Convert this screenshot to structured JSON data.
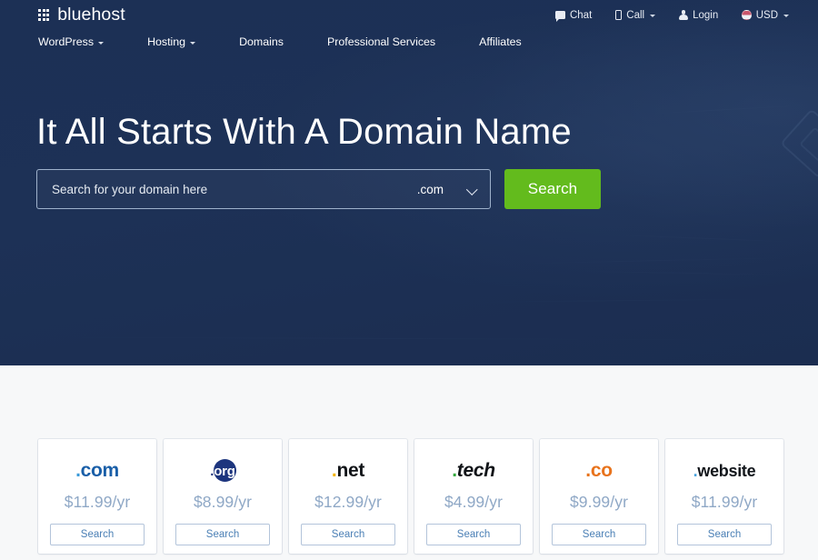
{
  "brand": {
    "name": "bluehost",
    "logo_icon": "grid-dots-icon"
  },
  "topbar": {
    "items": [
      {
        "label": "Chat",
        "icon": "chat-icon",
        "caret": false
      },
      {
        "label": "Call",
        "icon": "phone-icon",
        "caret": true
      },
      {
        "label": "Login",
        "icon": "user-icon",
        "caret": false
      },
      {
        "label": "USD",
        "icon": "currency-flag-icon",
        "caret": true
      }
    ]
  },
  "mainnav": {
    "items": [
      {
        "label": "WordPress",
        "caret": true
      },
      {
        "label": "Hosting",
        "caret": true
      },
      {
        "label": "Domains",
        "caret": false
      },
      {
        "label": "Professional Services",
        "caret": false
      },
      {
        "label": "Affiliates",
        "caret": false
      }
    ]
  },
  "hero": {
    "title": "It All Starts With A Domain Name",
    "background_color": "#1c3055"
  },
  "search": {
    "placeholder": "Search for your domain here",
    "value": "",
    "tld_selected": ".com",
    "dropdown_icon": "chevron-down-icon",
    "button_label": "Search",
    "button_color": "#63bb1d"
  },
  "tld_cards": {
    "button_label": "Search",
    "items": [
      {
        "tld": ".com",
        "name": "com",
        "price": "$11.99/yr",
        "dot_color": "#3a9ad9",
        "text_color": "#1a5fa8"
      },
      {
        "tld": ".org",
        "name": "org",
        "price": "$8.99/yr",
        "dot_color": "#1d357e",
        "text_color": "#1d357e"
      },
      {
        "tld": ".net",
        "name": "net",
        "price": "$12.99/yr",
        "dot_color": "#f2b300",
        "text_color": "#111418"
      },
      {
        "tld": ".tech",
        "name": "tech",
        "price": "$4.99/yr",
        "dot_color": "#36a93f",
        "text_color": "#111418"
      },
      {
        "tld": ".co",
        "name": "co",
        "price": "$9.99/yr",
        "dot_color": "#e8731c",
        "text_color": "#e8731c"
      },
      {
        "tld": ".website",
        "name": "website",
        "price": "$11.99/yr",
        "dot_color": "#4aa3dd",
        "text_color": "#12161b"
      }
    ]
  }
}
